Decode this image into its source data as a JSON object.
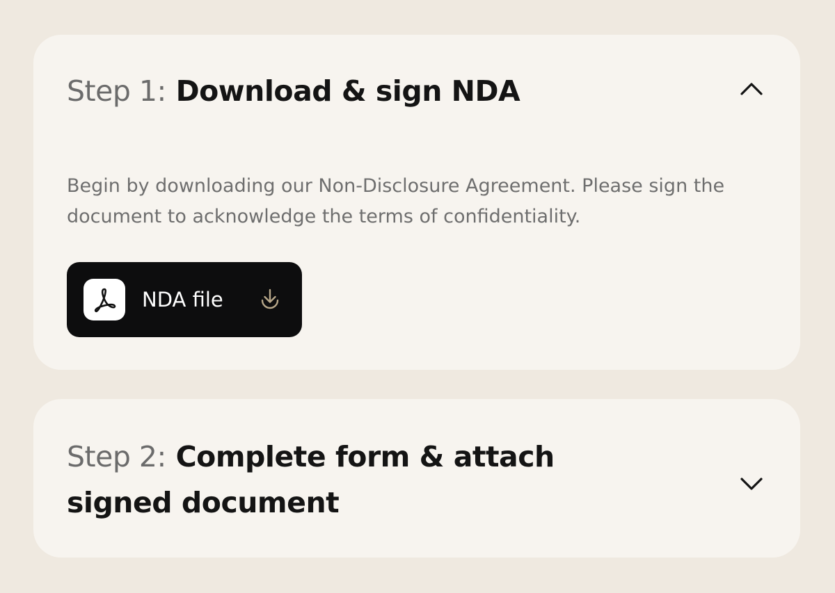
{
  "steps": [
    {
      "number": "Step 1:",
      "title": "Download & sign NDA",
      "expanded": true,
      "toggle_icon": "chevron-up-icon",
      "description": "Begin by downloading our Non-Disclosure Agreement. Please sign the document to acknowledge the terms of confidentiality.",
      "file": {
        "label": "NDA file",
        "file_icon": "pdf-icon",
        "action_icon": "download-icon"
      }
    },
    {
      "number": "Step 2:",
      "title": "Complete form & attach signed document",
      "expanded": false,
      "toggle_icon": "chevron-down-icon"
    }
  ],
  "colors": {
    "background": "#efe9e0",
    "card": "#f7f4ef",
    "title": "#141414",
    "step_number": "#6b6b6b",
    "body_text": "#6e6e6e",
    "button": "#0d0d0e",
    "download_accent": "#b8a88a"
  }
}
